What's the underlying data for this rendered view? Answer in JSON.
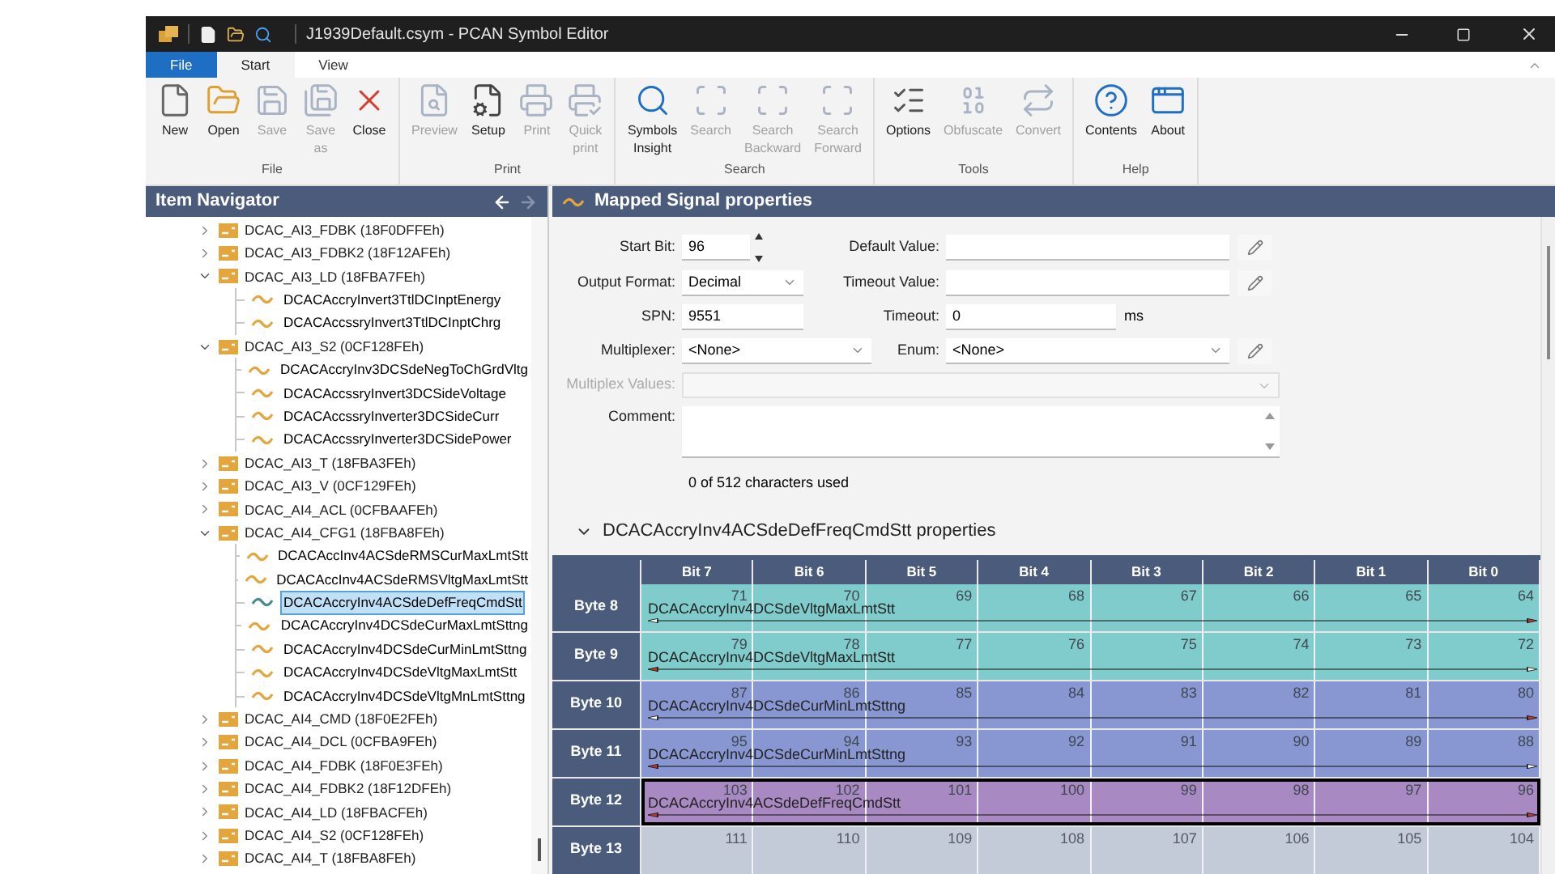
{
  "window": {
    "title": "J1939Default.csym - PCAN Symbol Editor"
  },
  "ribbon_tabs": [
    {
      "label": "File",
      "kind": "file",
      "selected": false
    },
    {
      "label": "Start",
      "kind": "tab",
      "selected": true
    },
    {
      "label": "View",
      "kind": "tab",
      "selected": false
    }
  ],
  "ribbon_groups": [
    {
      "label": "File",
      "buttons": [
        {
          "label": "New",
          "disabled": false
        },
        {
          "label": "Open",
          "disabled": false
        },
        {
          "label": "Save",
          "disabled": true
        },
        {
          "label": "Save as",
          "disabled": true
        },
        {
          "label": "Close",
          "disabled": false
        }
      ]
    },
    {
      "label": "Print",
      "buttons": [
        {
          "label": "Preview",
          "disabled": true
        },
        {
          "label": "Setup",
          "disabled": false
        },
        {
          "label": "Print",
          "disabled": true
        },
        {
          "label": "Quick print",
          "disabled": true
        }
      ]
    },
    {
      "label": "Search",
      "buttons": [
        {
          "label": "Symbols Insight",
          "disabled": false
        },
        {
          "label": "Search",
          "disabled": true
        },
        {
          "label": "Search Backward",
          "disabled": true
        },
        {
          "label": "Search Forward",
          "disabled": true
        }
      ]
    },
    {
      "label": "Tools",
      "buttons": [
        {
          "label": "Options",
          "disabled": false
        },
        {
          "label": "Obfuscate",
          "disabled": true
        },
        {
          "label": "Convert",
          "disabled": true
        }
      ]
    },
    {
      "label": "Help",
      "buttons": [
        {
          "label": "Contents",
          "disabled": false
        },
        {
          "label": "About",
          "disabled": false
        }
      ]
    }
  ],
  "navigator": {
    "title": "Item Navigator",
    "tree": [
      {
        "label": "DCAC_AI3_FDBK (18F0DFFEh)",
        "expanded": false
      },
      {
        "label": "DCAC_AI3_FDBK2 (18F12AFEh)",
        "expanded": false
      },
      {
        "label": "DCAC_AI3_LD (18FBA7FEh)",
        "expanded": true,
        "children": [
          {
            "label": "DCACAccryInvert3TtlDCInptEnergy",
            "selected": false
          },
          {
            "label": "DCACAccssryInvert3TtlDCInptChrg",
            "selected": false
          }
        ]
      },
      {
        "label": "DCAC_AI3_S2 (0CF128FEh)",
        "expanded": true,
        "children": [
          {
            "label": "DCACAccryInv3DCSdeNegToChGrdVltg",
            "selected": false
          },
          {
            "label": "DCACAccssryInvert3DCSideVoltage",
            "selected": false
          },
          {
            "label": "DCACAccssryInverter3DCSideCurr",
            "selected": false
          },
          {
            "label": "DCACAccssryInverter3DCSidePower",
            "selected": false
          }
        ]
      },
      {
        "label": "DCAC_AI3_T (18FBA3FEh)",
        "expanded": false
      },
      {
        "label": "DCAC_AI3_V (0CF129FEh)",
        "expanded": false
      },
      {
        "label": "DCAC_AI4_ACL (0CFBAAFEh)",
        "expanded": false
      },
      {
        "label": "DCAC_AI4_CFG1 (18FBA8FEh)",
        "expanded": true,
        "children": [
          {
            "label": "DCACAccInv4ACSdeRMSCurMaxLmtStt",
            "selected": false
          },
          {
            "label": "DCACAccInv4ACSdeRMSVltgMaxLmtStt",
            "selected": false
          },
          {
            "label": "DCACAccryInv4ACSdeDefFreqCmdStt",
            "selected": true
          },
          {
            "label": "DCACAccryInv4DCSdeCurMaxLmtSttng",
            "selected": false
          },
          {
            "label": "DCACAccryInv4DCSdeCurMinLmtSttng",
            "selected": false
          },
          {
            "label": "DCACAccryInv4DCSdeVltgMaxLmtStt",
            "selected": false
          },
          {
            "label": "DCACAccryInv4DCSdeVltgMnLmtSttng",
            "selected": false
          }
        ]
      },
      {
        "label": "DCAC_AI4_CMD (18F0E2FEh)",
        "expanded": false
      },
      {
        "label": "DCAC_AI4_DCL (0CFBA9FEh)",
        "expanded": false
      },
      {
        "label": "DCAC_AI4_FDBK (18F0E3FEh)",
        "expanded": false
      },
      {
        "label": "DCAC_AI4_FDBK2 (18F12DFEh)",
        "expanded": false
      },
      {
        "label": "DCAC_AI4_LD (18FBACFEh)",
        "expanded": false
      },
      {
        "label": "DCAC_AI4_S2 (0CF128FEh)",
        "expanded": false
      },
      {
        "label": "DCAC_AI4_T (18FBA8FEh)",
        "expanded": false
      }
    ]
  },
  "properties": {
    "title": "Mapped Signal properties",
    "start_bit": {
      "label": "Start Bit:",
      "value": "96"
    },
    "output_format": {
      "label": "Output Format:",
      "value": "Decimal"
    },
    "spn": {
      "label": "SPN:",
      "value": "9551"
    },
    "multiplexer": {
      "label": "Multiplexer:",
      "value": "<None>"
    },
    "multiplex_values": {
      "label": "Multiplex Values:",
      "disabled": true
    },
    "comment": {
      "label": "Comment:"
    },
    "char_count": "0 of 512 characters used",
    "default_value": {
      "label": "Default Value:"
    },
    "timeout_value": {
      "label": "Timeout Value:"
    },
    "timeout": {
      "label": "Timeout:",
      "value": "0",
      "unit": "ms"
    },
    "enum": {
      "label": "Enum:",
      "value": "<None>"
    }
  },
  "signal_section": {
    "title": "DCACAccryInv4ACSdeDefFreqCmdStt properties",
    "expanded": true
  },
  "bit_grid": {
    "columns": [
      "Bit 7",
      "Bit 6",
      "Bit 5",
      "Bit 4",
      "Bit 3",
      "Bit 2",
      "Bit 1",
      "Bit 0"
    ],
    "rows": [
      {
        "label": "Byte 8",
        "bits": [
          "71",
          "70",
          "69",
          "68",
          "67",
          "66",
          "65",
          "64"
        ],
        "signal": "DCACAccryInv4DCSdeVltgMaxLmtStt",
        "color": "#80cccc",
        "kind": "right",
        "selected": false
      },
      {
        "label": "Byte 9",
        "bits": [
          "79",
          "78",
          "77",
          "76",
          "75",
          "74",
          "73",
          "72"
        ],
        "signal": "DCACAccryInv4DCSdeVltgMaxLmtStt",
        "color": "#80cccc",
        "kind": "left",
        "selected": false
      },
      {
        "label": "Byte 10",
        "bits": [
          "87",
          "86",
          "85",
          "84",
          "83",
          "82",
          "81",
          "80"
        ],
        "signal": "DCACAccryInv4DCSdeCurMinLmtSttng",
        "color": "#8897d1",
        "kind": "right",
        "selected": false
      },
      {
        "label": "Byte 11",
        "bits": [
          "95",
          "94",
          "93",
          "92",
          "91",
          "90",
          "89",
          "88"
        ],
        "signal": "DCACAccryInv4DCSdeCurMinLmtSttng",
        "color": "#8897d1",
        "kind": "left",
        "selected": false
      },
      {
        "label": "Byte 12",
        "bits": [
          "103",
          "102",
          "101",
          "100",
          "99",
          "98",
          "97",
          "96"
        ],
        "signal": "DCACAccryInv4ACSdeDefFreqCmdStt",
        "color": "#a889c2",
        "kind": "both",
        "selected": true
      },
      {
        "label": "Byte 13",
        "bits": [
          "111",
          "110",
          "109",
          "108",
          "107",
          "106",
          "105",
          "104"
        ],
        "color": "#c3cad8",
        "selected": false
      }
    ]
  }
}
